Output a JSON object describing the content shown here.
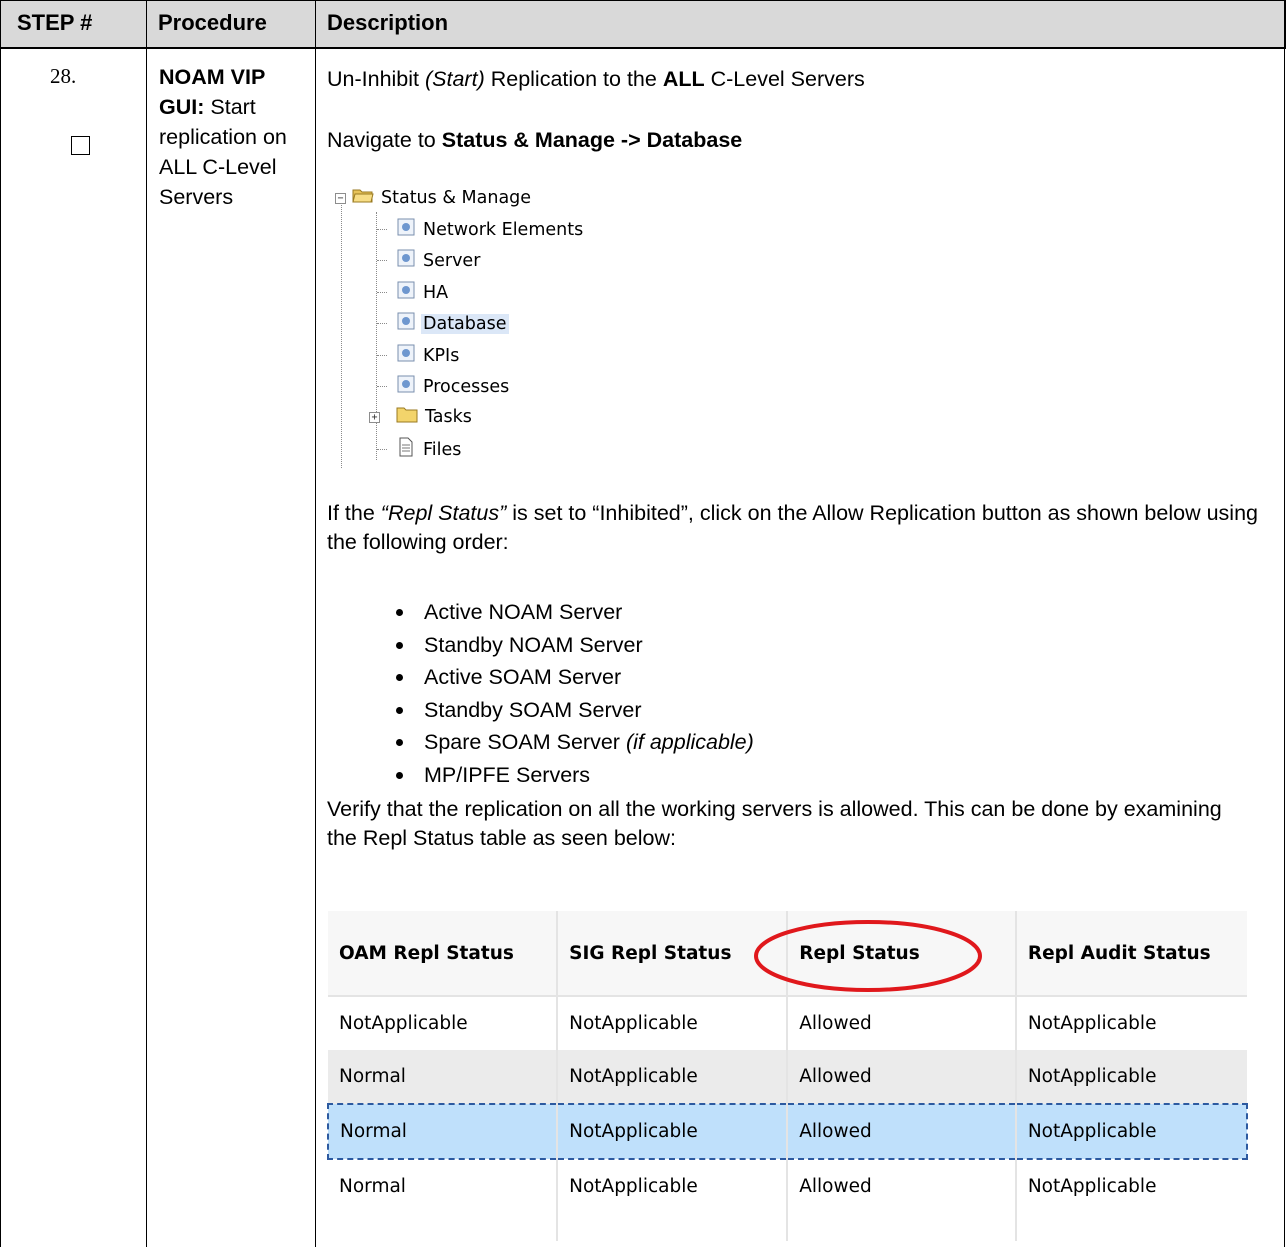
{
  "header": {
    "step_col": "STEP #",
    "procedure_col": "Procedure",
    "description_col": "Description"
  },
  "step": {
    "number": "28.",
    "procedure_bold": "NOAM VIP GUI:",
    "procedure_rest": "Start replication on ALL C-Level Servers"
  },
  "description": {
    "line1_a": "Un-Inhibit ",
    "line1_b": "(Start)",
    "line1_c": " Replication to the ",
    "line1_d": "ALL",
    "line1_e": " C-Level Servers",
    "nav_prefix": "Navigate to ",
    "nav_path": "Status & Manage -> Database",
    "para2_a": "If the ",
    "para2_b": "“Repl Status”",
    "para2_c": " is set to “Inhibited”, click on the Allow Replication button as shown below using the following order:",
    "bullets": [
      {
        "text": "Active NOAM Server",
        "italic": ""
      },
      {
        "text": "Standby NOAM Server",
        "italic": ""
      },
      {
        "text": "Active SOAM Server",
        "italic": ""
      },
      {
        "text": "Standby SOAM Server",
        "italic": ""
      },
      {
        "text": "Spare SOAM Server ",
        "italic": "(if applicable)"
      },
      {
        "text": "MP/IPFE Servers",
        "italic": ""
      }
    ],
    "para3": "Verify that the replication on all the working servers is allowed. This can be done by examining the Repl Status table as seen below:"
  },
  "tree": {
    "root": "Status & Manage",
    "items": [
      "Network Elements",
      "Server",
      "HA",
      "Database",
      "KPIs",
      "Processes",
      "Tasks",
      "Files"
    ],
    "selected": "Database"
  },
  "repl_table": {
    "headers": [
      "OAM Repl Status",
      "SIG Repl Status",
      "Repl Status",
      "Repl Audit Status"
    ],
    "rows": [
      [
        "NotApplicable",
        "NotApplicable",
        "Allowed",
        "NotApplicable"
      ],
      [
        "Normal",
        "NotApplicable",
        "Allowed",
        "NotApplicable"
      ],
      [
        "Normal",
        "NotApplicable",
        "Allowed",
        "NotApplicable"
      ],
      [
        "Normal",
        "NotApplicable",
        "Allowed",
        "NotApplicable"
      ]
    ],
    "highlight_color": "#e0181c"
  }
}
